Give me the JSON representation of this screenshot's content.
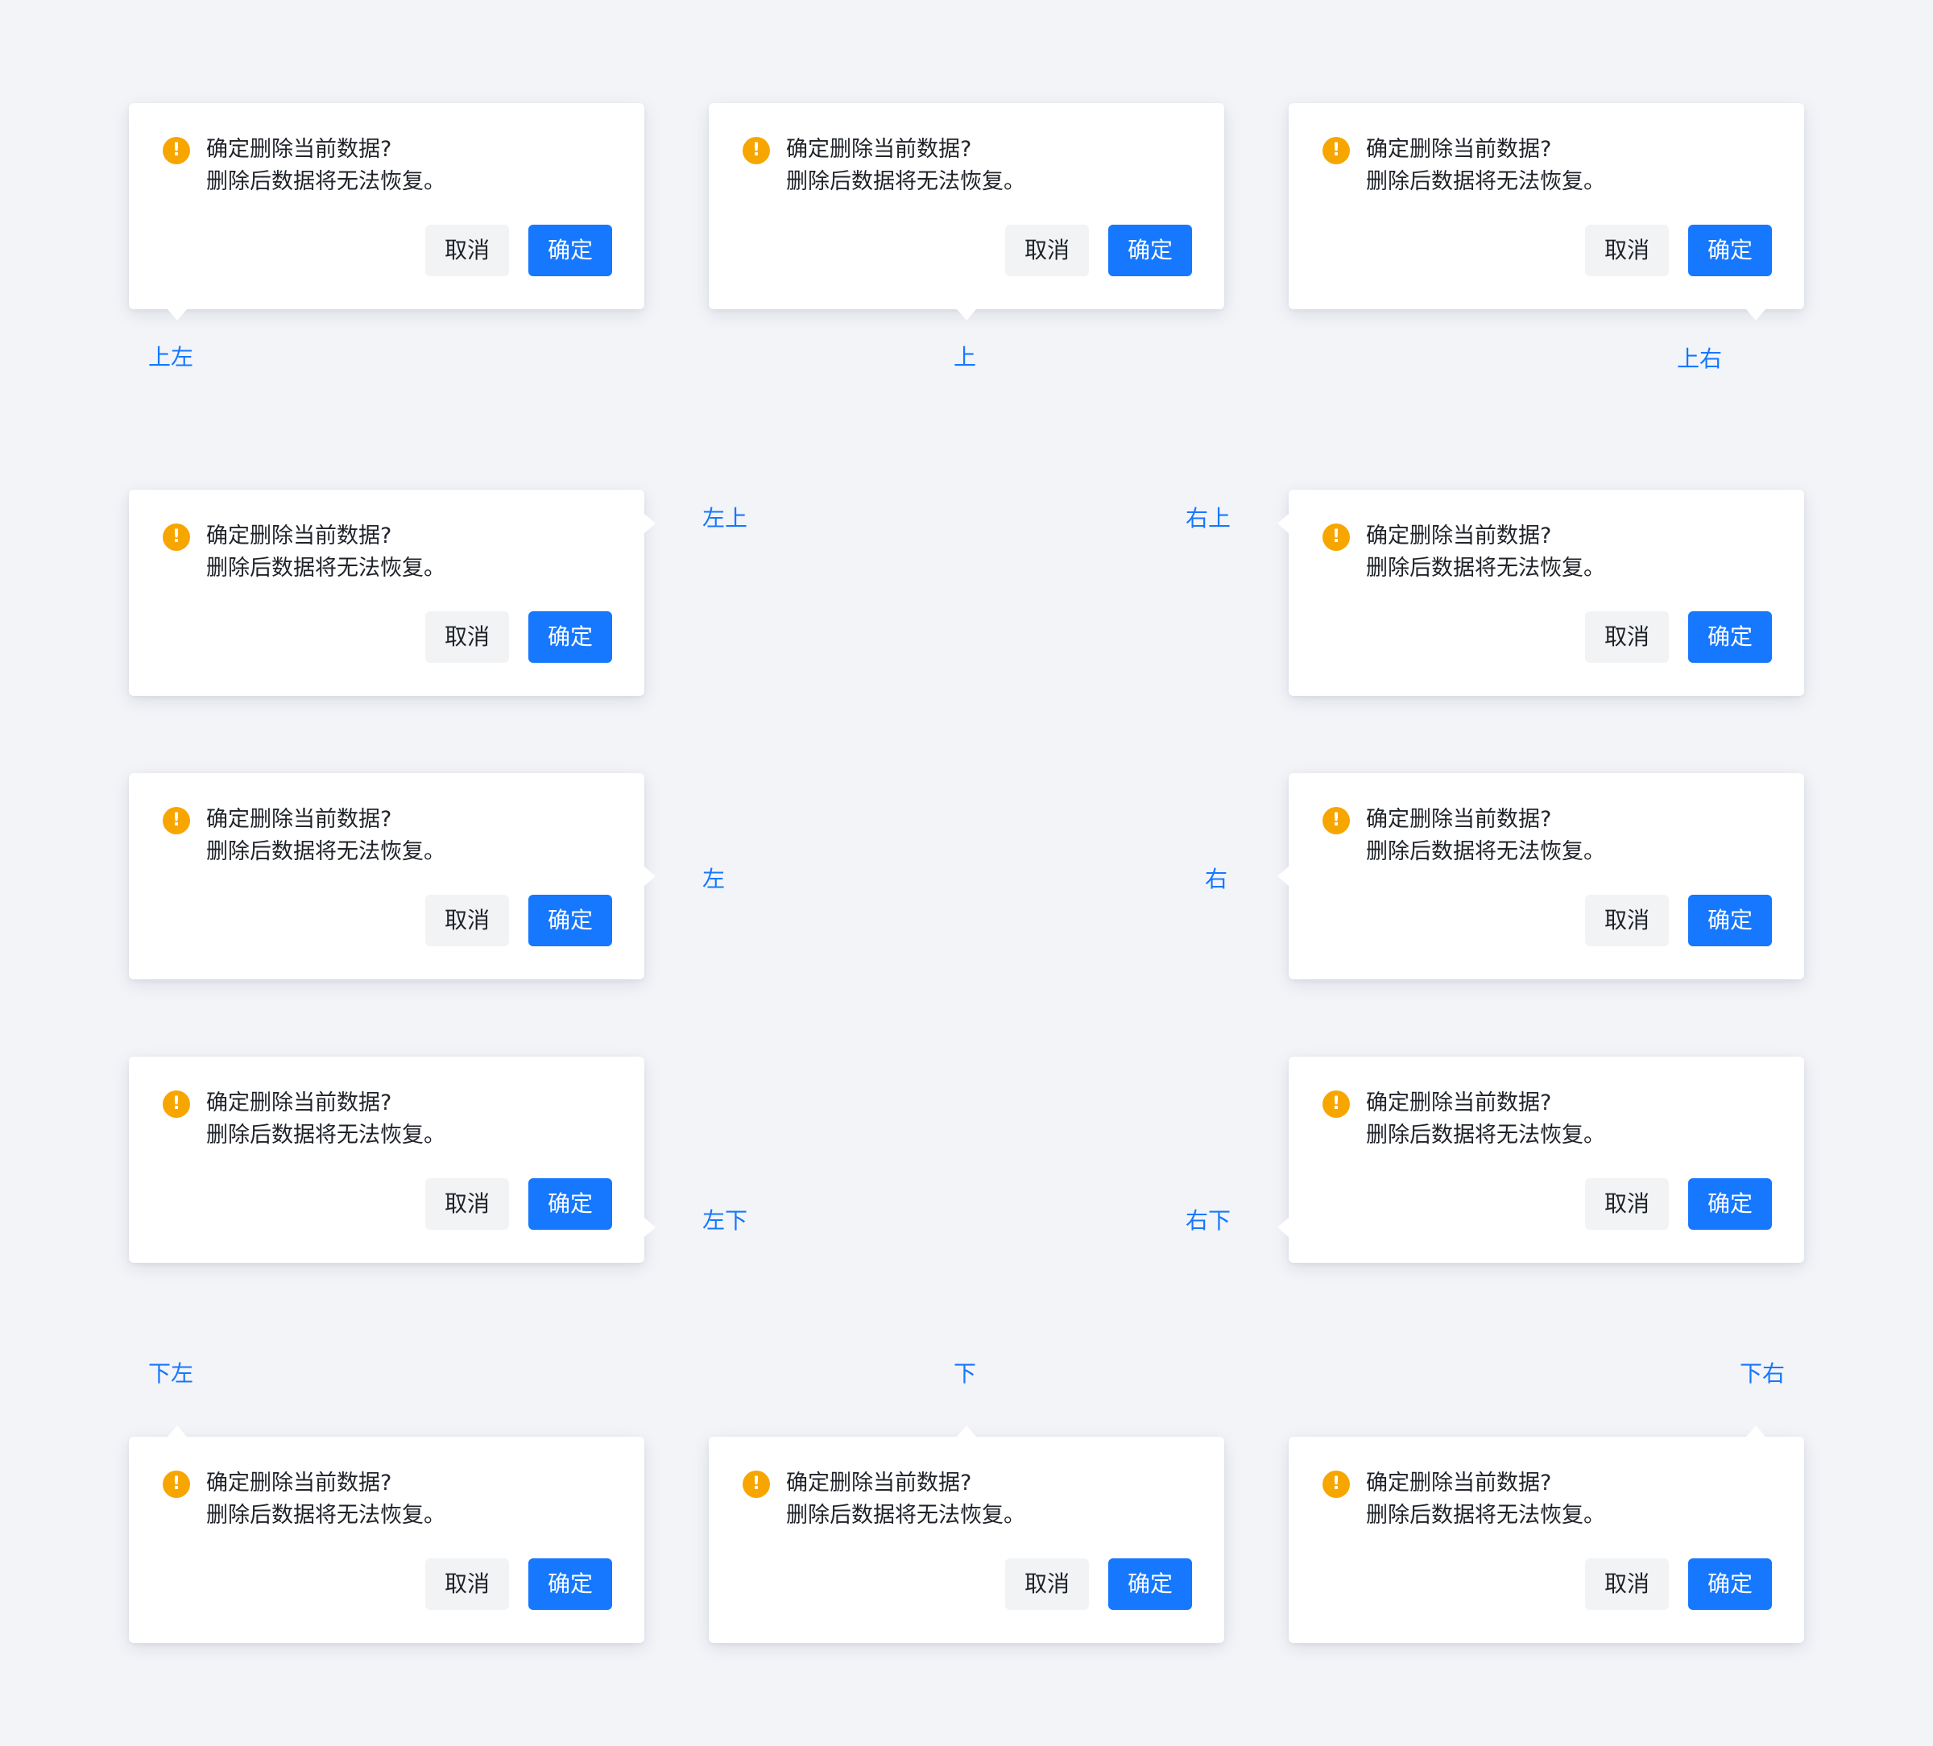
{
  "popconfirm": {
    "title": "确定删除当前数据?",
    "description": "删除后数据将无法恢复。",
    "cancel_label": "取消",
    "ok_label": "确定",
    "icon": "warning-icon",
    "icon_glyph": "!"
  },
  "colors": {
    "background": "#f2f4f8",
    "primary": "#1677ff",
    "warning": "#f7a600",
    "cancel_bg": "#f2f3f5",
    "text": "#1f2329"
  },
  "placements": {
    "top_left": "上左",
    "top": "上",
    "top_right": "上右",
    "left_top": "左上",
    "right_top": "右上",
    "left": "左",
    "right": "右",
    "left_bottom": "左下",
    "right_bottom": "右下",
    "bottom_left": "下左",
    "bottom": "下",
    "bottom_right": "下右"
  }
}
